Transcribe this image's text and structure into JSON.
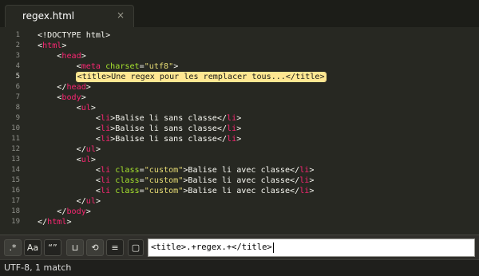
{
  "tab": {
    "title": "regex.html",
    "close_glyph": "×"
  },
  "editor": {
    "active_line": 5,
    "lines": [
      {
        "n": "1",
        "segs": [
          [
            "t",
            "<!DOCTYPE html>"
          ]
        ]
      },
      {
        "n": "2",
        "segs": [
          [
            "t",
            "<"
          ],
          [
            "g",
            "html"
          ],
          [
            "t",
            ">"
          ]
        ]
      },
      {
        "n": "3",
        "segs": [
          [
            "t",
            "    <"
          ],
          [
            "g",
            "head"
          ],
          [
            "t",
            ">"
          ]
        ]
      },
      {
        "n": "4",
        "segs": [
          [
            "t",
            "        <"
          ],
          [
            "g",
            "meta"
          ],
          [
            "t",
            " "
          ],
          [
            "a",
            "charset"
          ],
          [
            "t",
            "="
          ],
          [
            "s",
            "\"utf8\""
          ],
          [
            "t",
            ">"
          ]
        ]
      },
      {
        "n": "5",
        "segs": [
          [
            "t",
            "        "
          ],
          [
            "m",
            "<title>Une regex pour les remplacer tous...</title>"
          ]
        ]
      },
      {
        "n": "6",
        "segs": [
          [
            "t",
            "    </"
          ],
          [
            "g",
            "head"
          ],
          [
            "t",
            ">"
          ]
        ]
      },
      {
        "n": "7",
        "segs": [
          [
            "t",
            "    <"
          ],
          [
            "g",
            "body"
          ],
          [
            "t",
            ">"
          ]
        ]
      },
      {
        "n": "8",
        "segs": [
          [
            "t",
            "        <"
          ],
          [
            "g",
            "ul"
          ],
          [
            "t",
            ">"
          ]
        ]
      },
      {
        "n": "9",
        "segs": [
          [
            "t",
            "            <"
          ],
          [
            "g",
            "li"
          ],
          [
            "t",
            ">Balise li sans classe</"
          ],
          [
            "g",
            "li"
          ],
          [
            "t",
            ">"
          ]
        ]
      },
      {
        "n": "10",
        "segs": [
          [
            "t",
            "            <"
          ],
          [
            "g",
            "li"
          ],
          [
            "t",
            ">Balise li sans classe</"
          ],
          [
            "g",
            "li"
          ],
          [
            "t",
            ">"
          ]
        ]
      },
      {
        "n": "11",
        "segs": [
          [
            "t",
            "            <"
          ],
          [
            "g",
            "li"
          ],
          [
            "t",
            ">Balise li sans classe</"
          ],
          [
            "g",
            "li"
          ],
          [
            "t",
            ">"
          ]
        ]
      },
      {
        "n": "12",
        "segs": [
          [
            "t",
            "        </"
          ],
          [
            "g",
            "ul"
          ],
          [
            "t",
            ">"
          ]
        ]
      },
      {
        "n": "13",
        "segs": [
          [
            "t",
            "        <"
          ],
          [
            "g",
            "ul"
          ],
          [
            "t",
            ">"
          ]
        ]
      },
      {
        "n": "14",
        "segs": [
          [
            "t",
            "            <"
          ],
          [
            "g",
            "li"
          ],
          [
            "t",
            " "
          ],
          [
            "a",
            "class"
          ],
          [
            "t",
            "="
          ],
          [
            "s",
            "\"custom\""
          ],
          [
            "t",
            ">Balise li avec classe</"
          ],
          [
            "g",
            "li"
          ],
          [
            "t",
            ">"
          ]
        ]
      },
      {
        "n": "15",
        "segs": [
          [
            "t",
            "            <"
          ],
          [
            "g",
            "li"
          ],
          [
            "t",
            " "
          ],
          [
            "a",
            "class"
          ],
          [
            "t",
            "="
          ],
          [
            "s",
            "\"custom\""
          ],
          [
            "t",
            ">Balise li avec classe</"
          ],
          [
            "g",
            "li"
          ],
          [
            "t",
            ">"
          ]
        ]
      },
      {
        "n": "16",
        "segs": [
          [
            "t",
            "            <"
          ],
          [
            "g",
            "li"
          ],
          [
            "t",
            " "
          ],
          [
            "a",
            "class"
          ],
          [
            "t",
            "="
          ],
          [
            "s",
            "\"custom\""
          ],
          [
            "t",
            ">Balise li avec classe</"
          ],
          [
            "g",
            "li"
          ],
          [
            "t",
            ">"
          ]
        ]
      },
      {
        "n": "17",
        "segs": [
          [
            "t",
            "        </"
          ],
          [
            "g",
            "ul"
          ],
          [
            "t",
            ">"
          ]
        ]
      },
      {
        "n": "18",
        "segs": [
          [
            "t",
            "    </"
          ],
          [
            "g",
            "body"
          ],
          [
            "t",
            ">"
          ]
        ]
      },
      {
        "n": "19",
        "segs": [
          [
            "t",
            "</"
          ],
          [
            "g",
            "html"
          ],
          [
            "t",
            ">"
          ]
        ]
      }
    ]
  },
  "find": {
    "options": [
      {
        "name": "regex-toggle",
        "label": ".*",
        "on": true
      },
      {
        "name": "case-sensitive-toggle",
        "label": "Aa",
        "on": false
      },
      {
        "name": "whole-word-toggle",
        "label": "“”",
        "on": false
      },
      {
        "name": "wrap-toggle",
        "label": "⊔",
        "on": true
      },
      {
        "name": "in-selection-toggle",
        "label": "⟲",
        "on": true
      },
      {
        "name": "highlight-matches-toggle",
        "label": "≡",
        "on": false
      },
      {
        "name": "show-context-toggle",
        "label": "▢",
        "on": false
      }
    ],
    "query": "<title>.+regex.+</title>"
  },
  "status": {
    "text": "UTF-8, 1 match"
  },
  "colors": {
    "background": "#272822",
    "tag": "#f92672",
    "attribute": "#a6e22e",
    "string": "#e6db74",
    "match_highlight": "#ffe792"
  }
}
